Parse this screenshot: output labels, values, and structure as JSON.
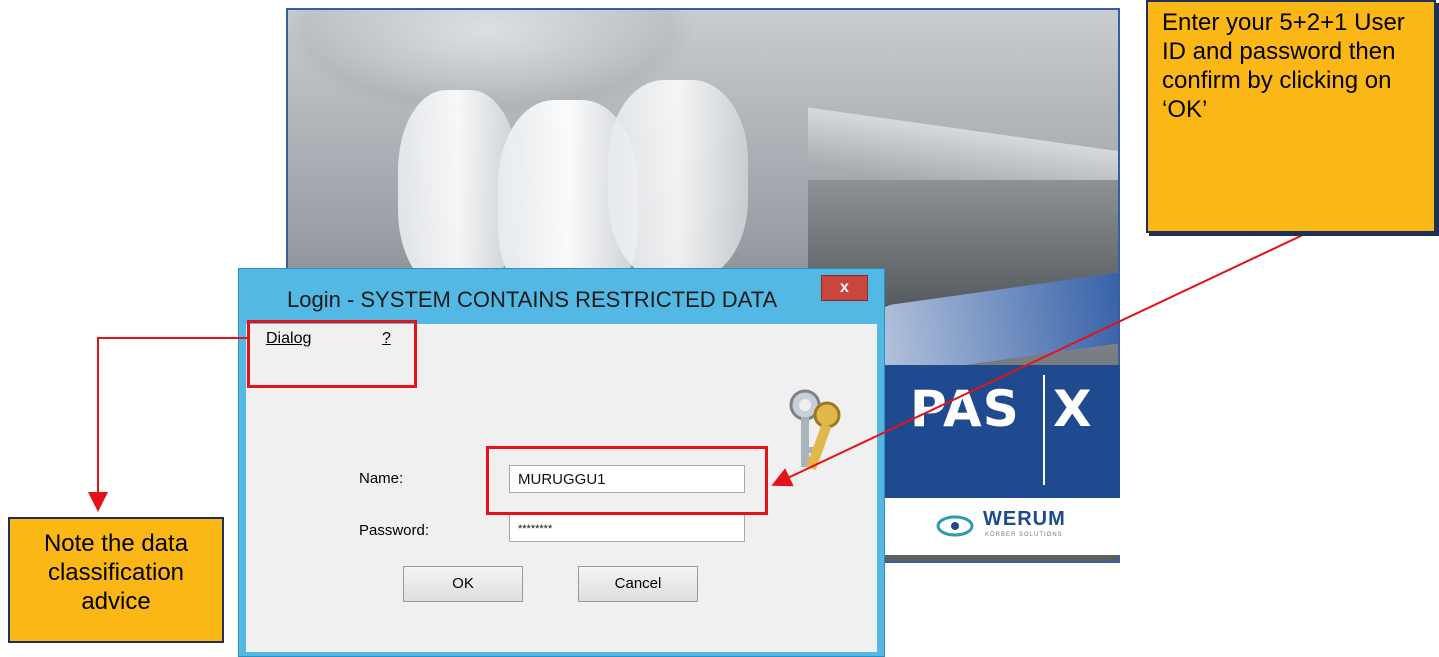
{
  "dialog": {
    "title": "Login - SYSTEM CONTAINS RESTRICTED DATA",
    "close_label": "x",
    "menu": [
      {
        "label": "Dialog"
      },
      {
        "label": "?"
      }
    ],
    "name_label": "Name:",
    "name_value": "MURUGGU1",
    "password_label": "Password:",
    "password_value": "********",
    "ok_label": "OK",
    "cancel_label": "Cancel"
  },
  "splash": {
    "brand_left": "PAS",
    "brand_right": "X",
    "company": "WERUM",
    "company_tagline": "KÖRBER SOLUTIONS"
  },
  "callouts": {
    "top": "Enter your 5+2+1 User ID and password then confirm by clicking on ‘OK’",
    "bottom": "Note the data classification advice"
  },
  "colors": {
    "accent_red": "#e3121b",
    "callout_fill": "#fbb715",
    "brand_blue": "#1f4a8f",
    "dialog_frame": "#54b8e4"
  }
}
